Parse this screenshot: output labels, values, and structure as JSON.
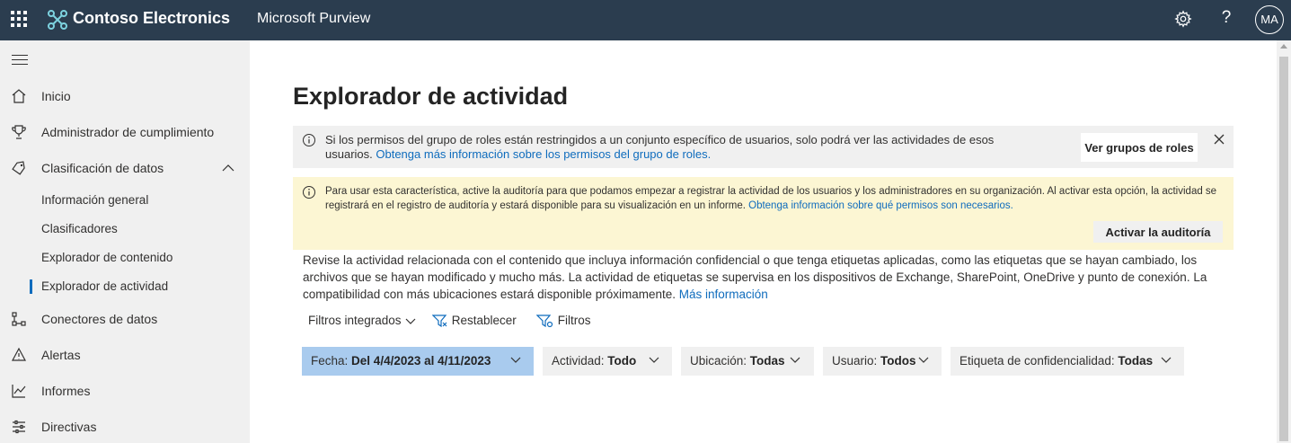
{
  "header": {
    "brand": "Contoso Electronics",
    "app": "Microsoft Purview",
    "avatar": "MA",
    "help": "?"
  },
  "sidebar": {
    "items": [
      {
        "label": "Inicio",
        "icon": "home-icon"
      },
      {
        "label": "Administrador de cumplimiento",
        "icon": "trophy-icon"
      },
      {
        "label": "Clasificación de datos",
        "icon": "tag-icon",
        "expanded": true
      },
      {
        "label": "Conectores de datos",
        "icon": "connector-icon"
      },
      {
        "label": "Alertas",
        "icon": "alert-icon"
      },
      {
        "label": "Informes",
        "icon": "chart-line-icon"
      },
      {
        "label": "Directivas",
        "icon": "policies-icon"
      }
    ],
    "subitems": [
      {
        "label": "Información general"
      },
      {
        "label": "Clasificadores"
      },
      {
        "label": "Explorador de contenido"
      },
      {
        "label": "Explorador de actividad",
        "selected": true
      }
    ]
  },
  "main": {
    "title": "Explorador de actividad",
    "info_bar": {
      "text": "Si los permisos del grupo de roles están restringidos a un conjunto específico de usuarios, solo podrá ver las actividades de esos usuarios. ",
      "link": "Obtenga más información sobre los permisos del grupo de roles.",
      "button": "Ver grupos de roles"
    },
    "warn_bar": {
      "text": "Para usar esta característica, active la auditoría para que podamos empezar a registrar la actividad de los usuarios y los administradores en su organización. Al activar esta opción, la actividad se registrará en el registro de auditoría y estará disponible para su visualización en un informe. ",
      "link": "Obtenga información sobre qué permisos son necesarios.",
      "button": "Activar la auditoría"
    },
    "description": {
      "text": "Revise la actividad relacionada con el contenido que incluya información confidencial o que tenga etiquetas aplicadas, como las etiquetas que se hayan cambiado, los archivos que se hayan modificado y mucho más. La actividad de etiquetas se supervisa en los dispositivos de Exchange, SharePoint, OneDrive y punto de conexión. La compatibilidad con más ubicaciones estará disponible próximamente. ",
      "link": "Más información"
    },
    "toolbar": {
      "builtin_filters": "Filtros integrados",
      "reset": "Restablecer",
      "filters": "Filtros"
    },
    "filters": [
      {
        "label": "Fecha:",
        "value": "Del 4/4/2023 al 4/11/2023"
      },
      {
        "label": "Actividad:",
        "value": "Todo"
      },
      {
        "label": "Ubicación:",
        "value": "Todas"
      },
      {
        "label": "Usuario:",
        "value": "Todos"
      },
      {
        "label": "Etiqueta de confidencialidad:",
        "value": "Todas"
      }
    ]
  },
  "colors": {
    "topbar": "#2b3d4f",
    "sidebar": "#f0f0f0",
    "accent": "#0f6cbd",
    "warning_bg": "#fcf6d3",
    "active_filter": "#a9cbee"
  }
}
